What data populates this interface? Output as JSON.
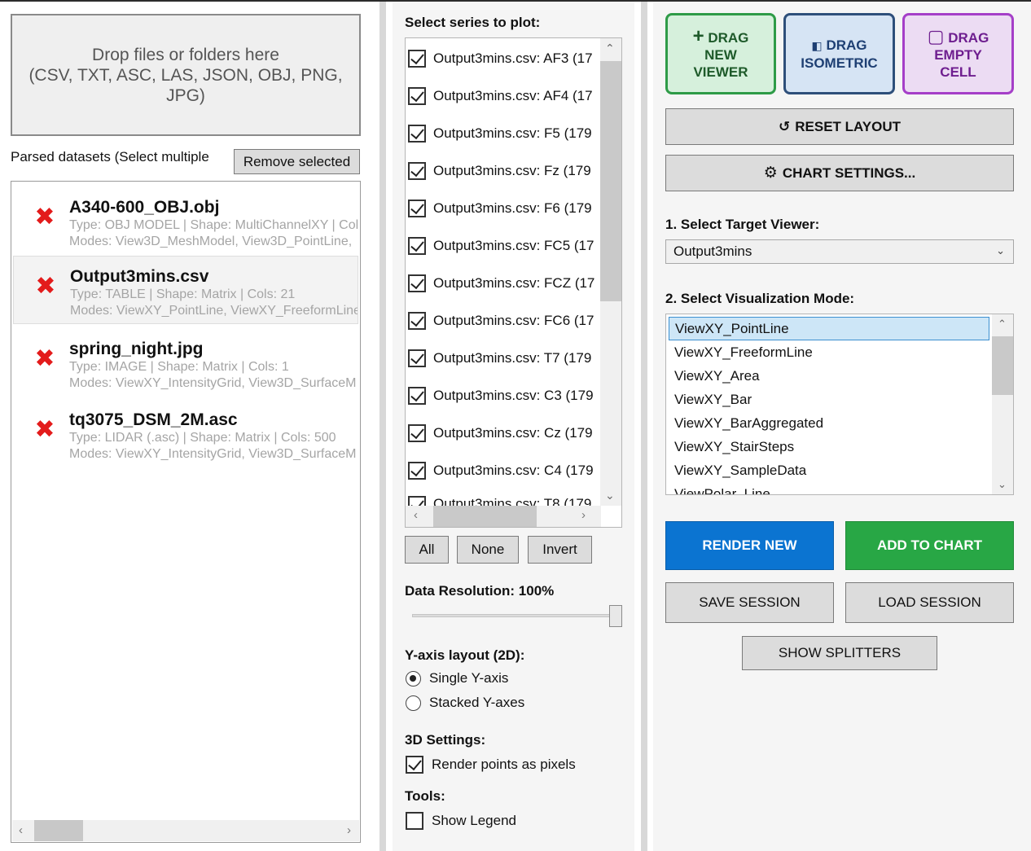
{
  "left": {
    "dropzone": {
      "line1": "Drop files or folders here",
      "line2": "(CSV, TXT, ASC, LAS, JSON, OBJ, PNG, JPG)"
    },
    "parsed_label": "Parsed datasets (Select multiple",
    "remove_label": "Remove selected",
    "datasets": [
      {
        "name": "A340-600_OBJ.obj",
        "type": "Type: OBJ MODEL | Shape: MultiChannelXY | Col",
        "modes": "Modes: View3D_MeshModel, View3D_PointLine,",
        "remove_icon": "✖"
      },
      {
        "name": "Output3mins.csv",
        "type": "Type: TABLE | Shape: Matrix | Cols: 21",
        "modes": "Modes: ViewXY_PointLine, ViewXY_FreeformLine",
        "remove_icon": "✖"
      },
      {
        "name": "spring_night.jpg",
        "type": "Type: IMAGE | Shape: Matrix | Cols: 1",
        "modes": "Modes: ViewXY_IntensityGrid, View3D_SurfaceM",
        "remove_icon": "✖"
      },
      {
        "name": "tq3075_DSM_2M.asc",
        "type": "Type: LIDAR (.asc) | Shape: Matrix | Cols: 500",
        "modes": "Modes: ViewXY_IntensityGrid, View3D_SurfaceM",
        "remove_icon": "✖"
      }
    ],
    "selected_index": 1
  },
  "middle": {
    "series_label": "Select series to plot:",
    "series": [
      "Output3mins.csv: AF3 (17",
      "Output3mins.csv: AF4 (17",
      "Output3mins.csv: F5 (179",
      "Output3mins.csv: Fz (179",
      "Output3mins.csv: F6 (179",
      "Output3mins.csv: FC5 (17",
      "Output3mins.csv: FCZ (17",
      "Output3mins.csv: FC6 (17",
      "Output3mins.csv: T7 (179",
      "Output3mins.csv: C3 (179",
      "Output3mins.csv: Cz (179",
      "Output3mins.csv: C4 (179",
      "Output3mins.csv: T8 (179"
    ],
    "all_label": "All",
    "none_label": "None",
    "invert_label": "Invert",
    "resolution_label": "Data Resolution: 100%",
    "resolution_value": 1.0,
    "yaxis_label": "Y-axis layout (2D):",
    "single_label": "Single Y-axis",
    "stacked_label": "Stacked Y-axes",
    "settings3d_label": "3D Settings:",
    "pixels_label": "Render points as pixels",
    "pixels_checked": true,
    "tools_label": "Tools:",
    "legend_label": "Show Legend",
    "legend_checked": false
  },
  "right": {
    "drag_new": {
      "icon": "+",
      "line1": "DRAG",
      "line2": "NEW",
      "line3": "VIEWER"
    },
    "drag_iso": {
      "icon": "◧",
      "line1": "DRAG",
      "line2": "ISOMETRIC"
    },
    "drag_empty": {
      "icon": "▢",
      "line1": "DRAG",
      "line2": "EMPTY",
      "line3": "CELL"
    },
    "reset_icon": "↺",
    "reset_label": "RESET LAYOUT",
    "settings_icon": "⚙",
    "settings_label": "CHART SETTINGS...",
    "target_label": "1. Select Target Viewer:",
    "target_value": "Output3mins",
    "mode_label": "2. Select Visualization Mode:",
    "modes": [
      "ViewXY_PointLine",
      "ViewXY_FreeformLine",
      "ViewXY_Area",
      "ViewXY_Bar",
      "ViewXY_BarAggregated",
      "ViewXY_StairSteps",
      "ViewXY_SampleData",
      "ViewPolar_Line"
    ],
    "render_label": "RENDER NEW",
    "add_label": "ADD TO CHART",
    "save_label": "SAVE SESSION",
    "load_label": "LOAD SESSION",
    "splitters_label": "SHOW SPLITTERS",
    "colors": {
      "render": "#0b74d1",
      "add": "#28a745",
      "drag_green": "#2e9b47",
      "drag_blue": "#2e4f7a",
      "drag_purple": "#a53fc8",
      "remove_x": "#e31b1b"
    }
  }
}
